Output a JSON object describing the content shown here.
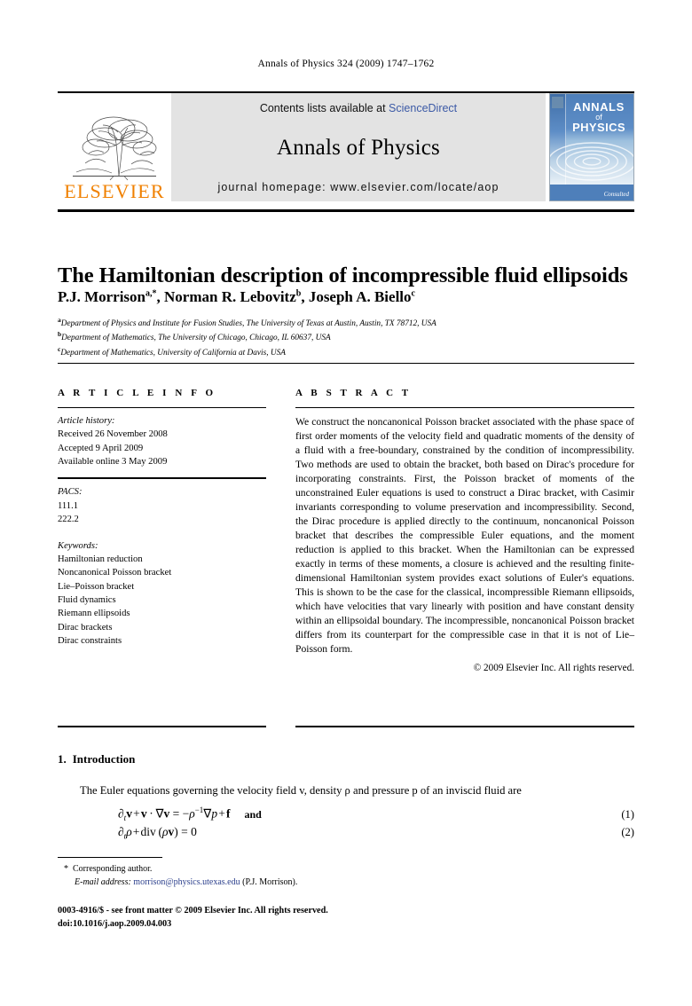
{
  "running_head": "Annals of Physics 324 (2009) 1747–1762",
  "masthead": {
    "contents_prefix": "Contents lists available at ",
    "contents_link": "ScienceDirect",
    "journal_name": "Annals of Physics",
    "homepage": "journal homepage: www.elsevier.com/locate/aop",
    "publisher_wordmark": "ELSEVIER",
    "cover": {
      "line1": "ANNALS",
      "line2": "of",
      "line3": "PHYSICS",
      "bottom_text": "Consulted"
    },
    "accent_blue": "#3c5aa6",
    "elsevier_orange": "#f08000",
    "band_gray": "#e3e3e3"
  },
  "article": {
    "title": "The Hamiltonian description of incompressible fluid ellipsoids",
    "authors": [
      {
        "name": "P.J. Morrison",
        "marks": "a,*"
      },
      {
        "name": "Norman R. Lebovitz",
        "marks": "b"
      },
      {
        "name": "Joseph A. Biello",
        "marks": "c"
      }
    ],
    "affiliations": [
      {
        "mark": "a",
        "text": "Department of Physics and Institute for Fusion Studies, The University of Texas at Austin, Austin, TX 78712, USA"
      },
      {
        "mark": "b",
        "text": "Department of Mathematics, The University of Chicago, Chicago, IL 60637, USA"
      },
      {
        "mark": "c",
        "text": "Department of Mathematics, University of California at Davis, USA"
      }
    ]
  },
  "article_info": {
    "heading": "A R T I C L E    I N F O",
    "history_label": "Article history:",
    "history": [
      "Received 26 November 2008",
      "Accepted 9 April 2009",
      "Available online 3 May 2009"
    ],
    "pacs_label": "PACS:",
    "pacs": [
      "111.1",
      "222.2"
    ],
    "keywords_label": "Keywords:",
    "keywords": [
      "Hamiltonian reduction",
      "Noncanonical Poisson bracket",
      "Lie–Poisson bracket",
      "Fluid dynamics",
      "Riemann ellipsoids",
      "Dirac brackets",
      "Dirac constraints"
    ]
  },
  "abstract": {
    "heading": "A B S T R A C T",
    "body": "We construct the noncanonical Poisson bracket associated with the phase space of first order moments of the velocity field and quadratic moments of the density of a fluid with a free-boundary, constrained by the condition of incompressibility. Two methods are used to obtain the bracket, both based on Dirac's procedure for incorporating constraints. First, the Poisson bracket of moments of the unconstrained Euler equations is used to construct a Dirac bracket, with Casimir invariants corresponding to volume preservation and incompressibility. Second, the Dirac procedure is applied directly to the continuum, noncanonical Poisson bracket that describes the compressible Euler equations, and the moment reduction is applied to this bracket. When the Hamiltonian can be expressed exactly in terms of these moments, a closure is achieved and the resulting finite-dimensional Hamiltonian system provides exact solutions of Euler's equations. This is shown to be the case for the classical, incompressible Riemann ellipsoids, which have velocities that vary linearly with position and have constant density within an ellipsoidal boundary. The incompressible, noncanonical Poisson bracket differs from its counterpart for the compressible case in that it is not of Lie–Poisson form.",
    "copyright": "© 2009 Elsevier Inc. All rights reserved."
  },
  "body": {
    "section_number": "1.",
    "section_title": "Introduction",
    "intro_paragraph": "The Euler equations governing the velocity field v, density ρ and pressure p of an inviscid fluid are",
    "equations": [
      {
        "number": "(1)",
        "trailing": "and"
      },
      {
        "number": "(2)",
        "trailing": ""
      }
    ]
  },
  "footnote": {
    "star": "*",
    "corresponding": "Corresponding author.",
    "email_label": "E-mail address:",
    "email": "morrison@physics.utexas.edu",
    "email_suffix": "(P.J. Morrison)."
  },
  "imprint": {
    "line1": "0003-4916/$ - see front matter © 2009 Elsevier Inc. All rights reserved.",
    "line2": "doi:10.1016/j.aop.2009.04.003"
  }
}
